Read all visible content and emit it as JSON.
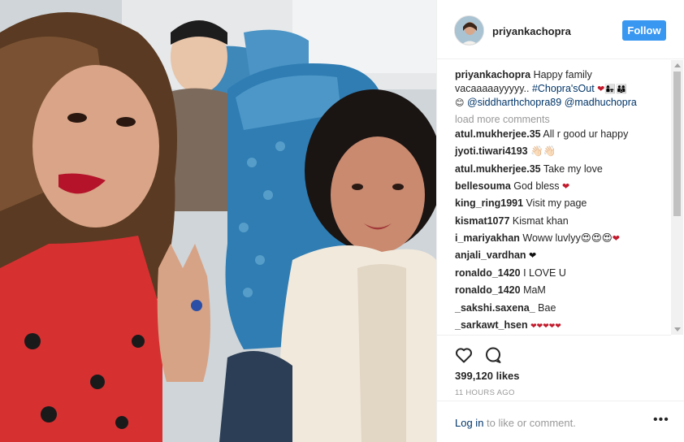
{
  "post": {
    "username": "priyankachopra",
    "follow_label": "Follow",
    "caption_username": "priyankachopra",
    "caption_text_1": " Happy family vacaaaaayyyyy.. ",
    "caption_hashtag": "#Chopra'sOut",
    "caption_mention_1": "@siddharthchopra89",
    "caption_mention_2": "@madhuchopra",
    "load_more": "load more comments",
    "likes": "399,120 likes",
    "time": "11 HOURS AGO",
    "login_link": "Log in",
    "login_suffix": " to like or comment.",
    "more_label": "•••"
  },
  "comments": [
    {
      "user": "atul.mukherjee.35",
      "text": " All r good ur happy"
    },
    {
      "user": "jyoti.tiwari4193",
      "text": " 👋🏻👋🏻"
    },
    {
      "user": "atul.mukherjee.35",
      "text": " Take my love"
    },
    {
      "user": "bellesouma",
      "text": " God bless ",
      "emoji": "❤"
    },
    {
      "user": "king_ring1991",
      "text": " Visit my page"
    },
    {
      "user": "kismat1077",
      "text": " Kismat khan"
    },
    {
      "user": "i_mariyakhan",
      "text": " Woww luvlyy😍😍😍",
      "emoji": "❤"
    },
    {
      "user": "anjali_vardhan",
      "text": " ",
      "emoji2": "❤"
    },
    {
      "user": "ronaldo_1420",
      "text": " I LOVE U"
    },
    {
      "user": "ronaldo_1420",
      "text": " MaM"
    },
    {
      "user": "_sakshi.saxena_",
      "text": " Bae"
    },
    {
      "user": "_sarkawt_hsen",
      "text": " ",
      "emoji": "❤❤❤❤❤"
    }
  ],
  "colors": {
    "follow_button": "#3897f0",
    "link": "#003569",
    "muted": "#999999",
    "heart": "#c21a2c"
  },
  "icons": {
    "like": "heart-outline-icon",
    "comment": "speech-bubble-icon"
  }
}
